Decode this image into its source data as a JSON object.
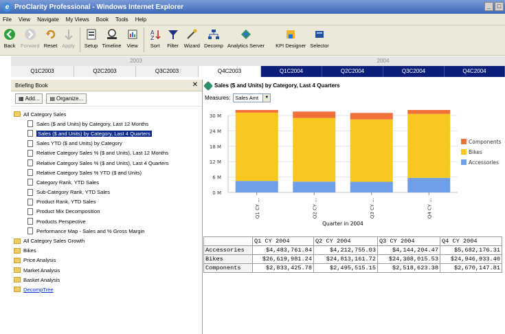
{
  "window": {
    "title": "ProClarity Professional - Windows Internet Explorer"
  },
  "menu": [
    "File",
    "View",
    "Navigate",
    "My Views",
    "Book",
    "Tools",
    "Help"
  ],
  "toolbar": {
    "back": "Back",
    "forward": "Forward",
    "reset": "Reset",
    "apply": "Apply",
    "setup": "Setup",
    "timeline": "Timeline",
    "view": "View",
    "sort": "Sort",
    "filter": "Filter",
    "wizard": "Wizard",
    "decomp": "Decomp",
    "analytics_server": "Analytics Server",
    "kpi_designer": "KPI Designer",
    "selector": "Selector"
  },
  "timeline": {
    "year_2003": "2003",
    "year_2004": "2004",
    "quarters": [
      "Q1C2003",
      "Q2C2003",
      "Q3C2003",
      "Q4C2003",
      "Q1C2004",
      "Q2C2004",
      "Q3C2004",
      "Q4C2004"
    ]
  },
  "briefing_book": {
    "title": "Briefing Book",
    "add_label": "Add...",
    "organize_label": "Organize...",
    "tree": [
      {
        "label": "All Category Sales",
        "kind": "folder",
        "level": 0
      },
      {
        "label": "Sales ($ and Units) by Category, Last 12 Months",
        "kind": "doc",
        "level": 1
      },
      {
        "label": "Sales ($ and Units) by Category, Last 4 Quarters",
        "kind": "doc",
        "level": 1,
        "selected": true
      },
      {
        "label": "Sales YTD ($ and Units) by Category",
        "kind": "doc",
        "level": 1
      },
      {
        "label": "Relative Category Sales % ($ and Units), Last 12 Months",
        "kind": "doc",
        "level": 1
      },
      {
        "label": "Relative Category Sales % ($ and Units), Last 4 Quarters",
        "kind": "doc",
        "level": 1
      },
      {
        "label": "Relative Category Sales % YTD ($ and Units)",
        "kind": "doc",
        "level": 1
      },
      {
        "label": "Category Rank, YTD Sales",
        "kind": "doc",
        "level": 1
      },
      {
        "label": "Sub-Category Rank, YTD Sales",
        "kind": "doc",
        "level": 1
      },
      {
        "label": "Product Rank, YTD Sales",
        "kind": "doc",
        "level": 1
      },
      {
        "label": "Product Mix Decomposition",
        "kind": "doc",
        "level": 1
      },
      {
        "label": "Products Perspective",
        "kind": "doc",
        "level": 1
      },
      {
        "label": "Performance Map - Sales and % Gross Margin",
        "kind": "doc",
        "level": 1
      },
      {
        "label": "All Category Sales Growth",
        "kind": "folder",
        "level": 0
      },
      {
        "label": "Bikes",
        "kind": "folder",
        "level": 0
      },
      {
        "label": "Price Analysis",
        "kind": "folder",
        "level": 0
      },
      {
        "label": "Market Analysis",
        "kind": "folder",
        "level": 0
      },
      {
        "label": "Basket Analysis",
        "kind": "folder",
        "level": 0
      },
      {
        "label": "DecompTree",
        "kind": "folder",
        "level": 0,
        "link": true
      }
    ]
  },
  "view": {
    "title": "Sales ($ and Units) by Category, Last 4 Quarters",
    "measures_label": "Measures:",
    "measures_value": "Sales Amt"
  },
  "chart_data": {
    "type": "bar",
    "stacked": true,
    "categories": [
      "Q1 CY ...",
      "Q2 CY ...",
      "Q3 CY ...",
      "Q4 CY ..."
    ],
    "xlabel": "Quarter in 2004",
    "ylabel": "",
    "ylim": [
      0,
      30000000
    ],
    "yticks": [
      "0 M",
      "6 M",
      "12 M",
      "18 M",
      "24 M",
      "30 M"
    ],
    "legend_position": "right",
    "series": [
      {
        "name": "Accessories",
        "color": "#6f9fe8",
        "values": [
          4483761.84,
          4212755.03,
          4144204.47,
          5682176.31
        ]
      },
      {
        "name": "Bikes",
        "color": "#f8c720",
        "values": [
          26619981.24,
          24813161.72,
          24308015.53,
          24946933.4
        ]
      },
      {
        "name": "Components",
        "color": "#f0703a",
        "values": [
          2833425.78,
          2495515.15,
          2518623.38,
          2670147.81
        ]
      }
    ]
  },
  "table": {
    "headers": [
      "",
      "Q1 CY  2004",
      "Q2 CY  2004",
      "Q3 CY  2004",
      "Q4 CY  2004"
    ],
    "rows": [
      [
        "Accessories",
        "$4,483,761.84",
        "$4,212,755.03",
        "$4,144,204.47",
        "$5,682,176.31"
      ],
      [
        "Bikes",
        "$26,619,981.24",
        "$24,813,161.72",
        "$24,308,015.53",
        "$24,946,933.40"
      ],
      [
        "Components",
        "$2,833,425.78",
        "$2,495,515.15",
        "$2,518,623.38",
        "$2,670,147.81"
      ]
    ]
  }
}
